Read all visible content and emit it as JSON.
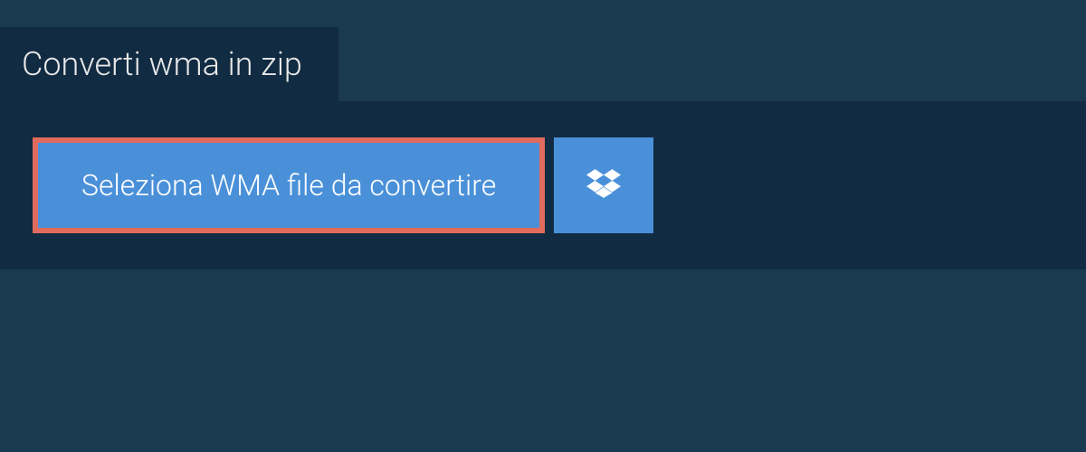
{
  "tab": {
    "title": "Converti wma in zip"
  },
  "actions": {
    "select_file_label": "Seleziona WMA file da convertire"
  }
}
